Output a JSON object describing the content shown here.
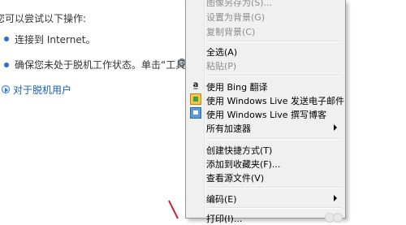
{
  "background_text": {
    "intro": "您可以尝试以下操作:",
    "bullets": [
      "连接到 Internet。",
      "确保您未处于脱机工作状态。单击“工具”"
    ],
    "link": "对于脱机用户"
  },
  "context_menu": {
    "items": [
      {
        "label": "图像另存为(S)...",
        "disabled": true
      },
      {
        "label": "设置为背景(G)",
        "disabled": true
      },
      {
        "label": "复制背景(C)",
        "disabled": true
      },
      {
        "label": "全选(A)",
        "disabled": false
      },
      {
        "label": "粘贴(P)",
        "disabled": true
      },
      {
        "label": "使用 Bing 翻译",
        "disabled": false,
        "icon": "bing-translate-icon"
      },
      {
        "label": "使用 Windows Live 发送电子邮件",
        "disabled": false,
        "icon": "windows-live-mail-icon"
      },
      {
        "label": "使用 Windows Live 撰写博客",
        "disabled": false,
        "icon": "windows-live-writer-icon"
      },
      {
        "label": "所有加速器",
        "disabled": false,
        "submenu": true
      },
      {
        "label": "创建快捷方式(T)",
        "disabled": false
      },
      {
        "label": "添加到收藏夹(F)...",
        "disabled": false
      },
      {
        "label": "查看源文件(V)",
        "disabled": false
      },
      {
        "label": "编码(E)",
        "disabled": false,
        "submenu": true
      },
      {
        "label": "打印(I)...",
        "disabled": false
      }
    ]
  },
  "colors": {
    "menu_background": "#f0f0f0",
    "link": "#1a5fb4",
    "disabled_text": "#8d8d8d"
  }
}
